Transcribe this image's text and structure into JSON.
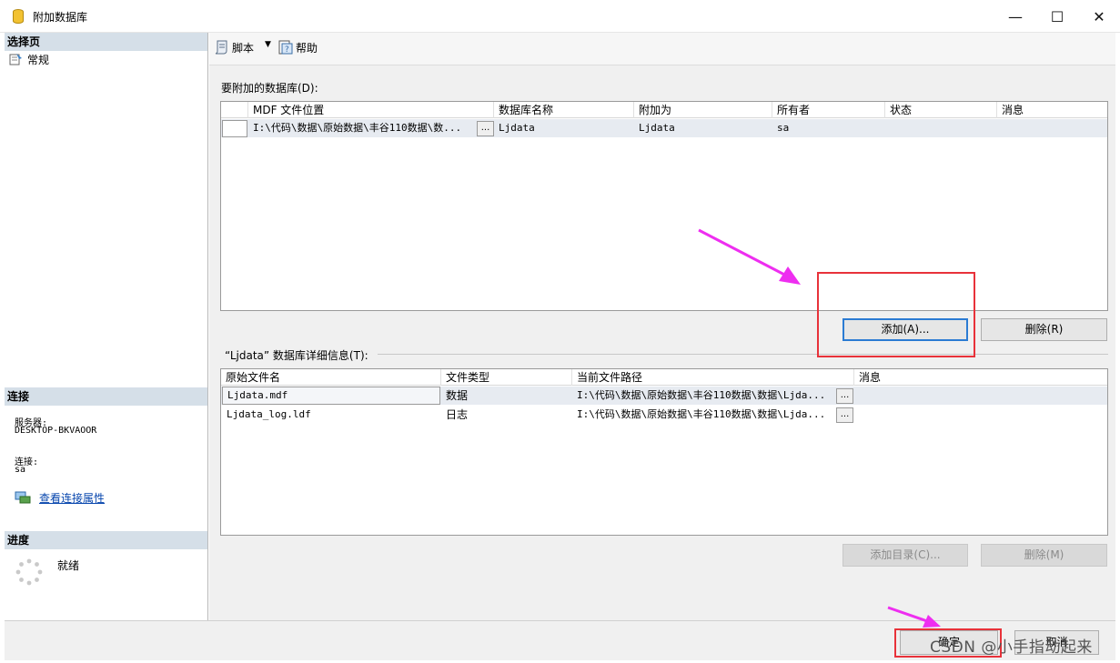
{
  "window": {
    "title": "附加数据库"
  },
  "left": {
    "select_page_header": "选择页",
    "pages": [
      "常规"
    ],
    "connection_header": "连接",
    "server_label": "服务器:",
    "server_value": "DESKTOP-BKVAOOR",
    "connection_label": "连接:",
    "connection_value": "sa",
    "view_props_link": "查看连接属性",
    "progress_header": "进度",
    "progress_status": "就绪"
  },
  "toolbar": {
    "script_label": "脚本",
    "help_label": "帮助"
  },
  "attach_section": {
    "label": "要附加的数据库(D):",
    "columns": [
      "MDF 文件位置",
      "数据库名称",
      "附加为",
      "所有者",
      "状态",
      "消息"
    ],
    "rows": [
      {
        "mdf": "I:\\代码\\数据\\原始数据\\丰谷110数据\\数...",
        "db_name": "Ljdata",
        "attach_as": "Ljdata",
        "owner": "sa",
        "status": "",
        "message": ""
      }
    ],
    "add_button": "添加(A)...",
    "remove_button": "删除(R)"
  },
  "details_section": {
    "label": "“Ljdata” 数据库详细信息(T):",
    "columns": [
      "原始文件名",
      "文件类型",
      "当前文件路径",
      "消息"
    ],
    "rows": [
      {
        "name": "Ljdata.mdf",
        "type": "数据",
        "path": "I:\\代码\\数据\\原始数据\\丰谷110数据\\数据\\Ljda...",
        "message": ""
      },
      {
        "name": "Ljdata_log.ldf",
        "type": "日志",
        "path": "I:\\代码\\数据\\原始数据\\丰谷110数据\\数据\\Ljda...",
        "message": ""
      }
    ],
    "add_catalog_button": "添加目录(C)...",
    "remove_button": "删除(M)"
  },
  "footer": {
    "ok_button": "确定",
    "cancel_button": "取消"
  },
  "watermark": "CSDN @小手指动起来",
  "colors": {
    "annotation_box": "#e8323a",
    "annotation_arrow": "#ee2ef0",
    "section_header": "#d5dfe8"
  }
}
